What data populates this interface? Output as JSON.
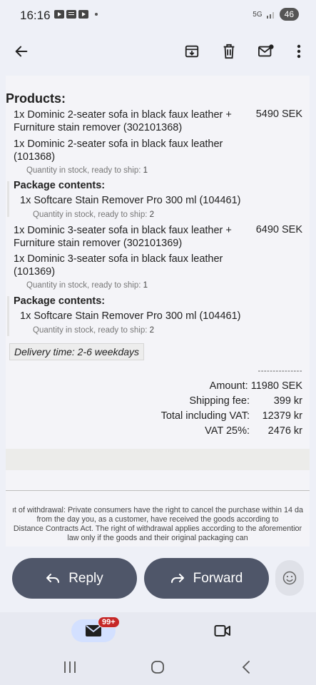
{
  "status_bar": {
    "time": "16:16",
    "battery": "46",
    "signal": "5G"
  },
  "toolbar": {
    "back_icon": "arrow-left-icon",
    "archive_icon": "archive-icon",
    "delete_icon": "trash-icon",
    "unread_icon": "mark-unread-icon",
    "more_icon": "more-vert-icon"
  },
  "email": {
    "products_title": "Products:",
    "items": [
      {
        "text": "1x Dominic 2-seater sofa in black faux leather + Furniture stain remover (302101368)",
        "price": "5490 SEK"
      },
      {
        "text": "1x Dominic 2-seater sofa in black faux leather (101368)",
        "stock_label": "Quantity in stock, ready to ship:",
        "stock_value": "1"
      },
      {
        "package_title": "Package contents:",
        "text": "1x Softcare Stain Remover Pro 300 ml (104461)",
        "stock_label": "Quantity in stock, ready to ship:",
        "stock_value": "2"
      },
      {
        "text": "1x Dominic 3-seater sofa in black faux leather + Furniture stain remover (302101369)",
        "price": "6490 SEK"
      },
      {
        "text": "1x Dominic 3-seater sofa in black faux leather (101369)",
        "stock_label": "Quantity in stock, ready to ship:",
        "stock_value": "1"
      },
      {
        "package_title": "Package contents:",
        "text": "1x Softcare Stain Remover Pro 300 ml (104461)",
        "stock_label": "Quantity in stock, ready to ship:",
        "stock_value": "2"
      }
    ],
    "delivery": "Delivery time: 2-6 weekdays",
    "dashes": "---------------",
    "amount": "Amount: 11980 SEK",
    "totals": [
      {
        "label": "Shipping fee:",
        "value": "399 kr"
      },
      {
        "label": "Total including VAT:",
        "value": "12379 kr"
      },
      {
        "label": "VAT 25%:",
        "value": "2476 kr"
      }
    ],
    "legal": [
      "ıt of withdrawal: Private consumers have the right to cancel the purchase within 14 da",
      "from the day you, as a customer, have received the goods according to",
      "Distance Contracts Act. The right of withdrawal applies according to the aforementior",
      "law only if the goods and their original packaging can"
    ]
  },
  "actions": {
    "reply_label": "Reply",
    "forward_label": "Forward"
  },
  "bottom_nav": {
    "mail_badge": "99+"
  },
  "colors": {
    "button_bg": "#4f5669",
    "badge_red": "#c62828",
    "pill_blue": "#d3e0ff"
  }
}
